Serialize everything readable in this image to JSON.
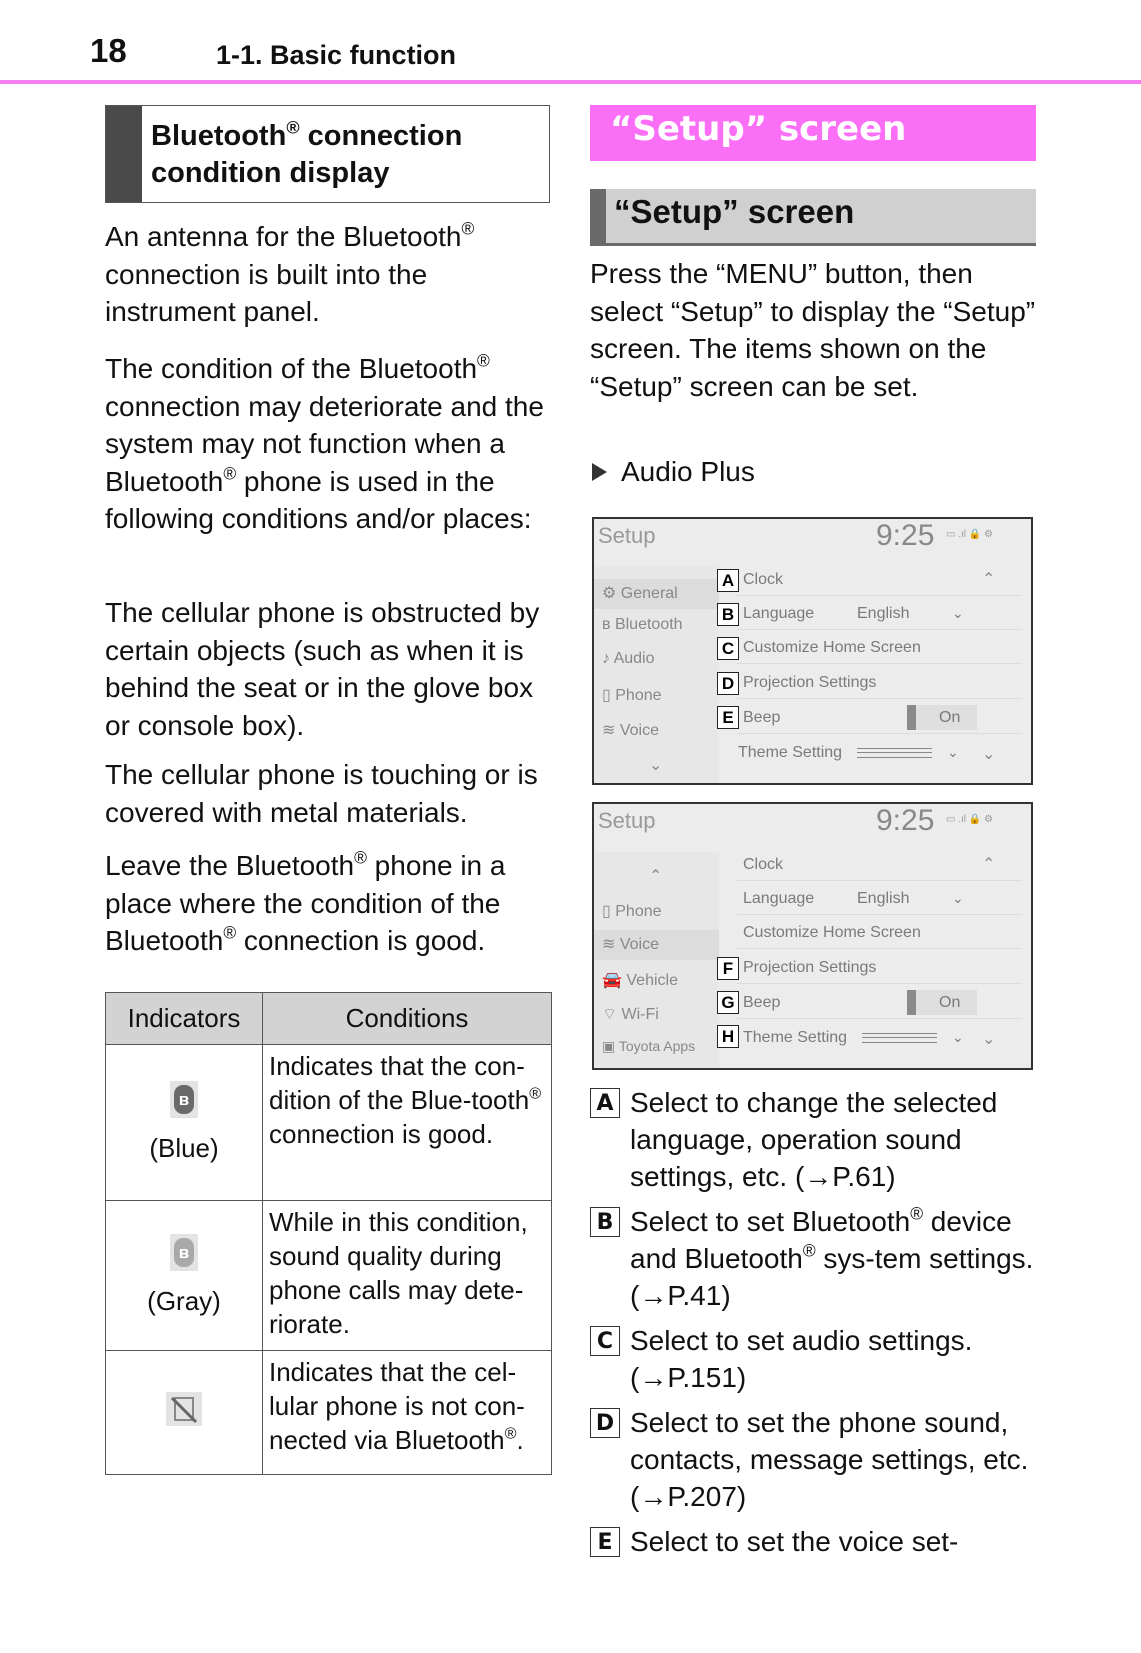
{
  "header": {
    "page_number": "18",
    "chapter": "1-1. Basic function",
    "accent_color": "#f47ef0"
  },
  "left": {
    "section_title_line1": "Bluetooth",
    "section_title_line1_rest": " connection",
    "section_title_line2": "condition display",
    "para1": [
      "An antenna for the Bluetooth",
      "connection is built into the instrument panel."
    ],
    "para2_a": "The condition of the Bluetooth",
    "para2_b": "connection may deteriorate and the system may not function when a Bluetooth",
    "para2_c": "phone is used in the following conditions and/or places:",
    "para3": "The cellular phone is obstructed by certain objects (such as when it is behind the seat or in the glove box or console box).",
    "para4": "The cellular phone is touching or is covered with metal materials.",
    "para5_a": "Leave the Bluetooth",
    "para5_b": "phone in a place where the condition of the Bluetooth",
    "para5_c": "connection is good.",
    "reg": "®",
    "table": {
      "headers": [
        "Indicators",
        "Conditions"
      ],
      "rows": [
        {
          "icon": "bluetooth-blue-icon",
          "icon_color": "#6a6a6a",
          "label": "(Blue)",
          "condition_a": "Indicates that the con-dition of the Blue-tooth",
          "condition_b": "connection is good."
        },
        {
          "icon": "bluetooth-gray-icon",
          "icon_color": "#a9a9a9",
          "label": "(Gray)",
          "condition_a": "While in this condition, sound quality during phone calls may dete-riorate.",
          "condition_b": ""
        },
        {
          "icon": "phone-not-connected-icon",
          "icon_color": "#888888",
          "label": "",
          "condition_a": "Indicates that the cel-lular phone is not con-nected via Bluetooth",
          "condition_b": "."
        }
      ]
    }
  },
  "right": {
    "pink_title": "“Setup” screen",
    "gray_title": "“Setup” screen",
    "intro": "Press the “MENU” button, then select “Setup” to display the “Setup” screen. The items shown on the “Setup” screen can be set.",
    "bullet": "Audio Plus",
    "screen1": {
      "title": "Setup",
      "time": "9:25",
      "sidebar": [
        "General",
        "Bluetooth",
        "Audio",
        "Phone",
        "Voice"
      ],
      "rows": [
        "Clock",
        "Language",
        "Customize Home Screen",
        "Projection Settings",
        "Beep",
        "Theme Setting"
      ],
      "language_value": "English",
      "beep_value": "On",
      "callouts": [
        "A",
        "B",
        "C",
        "D",
        "E"
      ]
    },
    "screen2": {
      "title": "Setup",
      "time": "9:25",
      "sidebar": [
        "Phone",
        "Voice",
        "Vehicle",
        "Wi-Fi",
        "Toyota Apps"
      ],
      "rows": [
        "Clock",
        "Language",
        "Customize Home Screen",
        "Projection Settings",
        "Beep",
        "Theme Setting"
      ],
      "language_value": "English",
      "beep_value": "On",
      "callouts": [
        "F",
        "G",
        "H"
      ]
    },
    "legend": [
      {
        "key": "A",
        "text": "Select to change the selected language, operation sound settings, etc. (→P.61)"
      },
      {
        "key": "B",
        "text_a": "Select to set Bluetooth",
        "text_b": "device and Bluetooth",
        "text_c": "sys-tem settings. (→P.41)"
      },
      {
        "key": "C",
        "text": "Select to set audio settings. (→P.151)"
      },
      {
        "key": "D",
        "text": "Select to set the phone sound, contacts, message settings, etc. (→P.207)"
      },
      {
        "key": "E",
        "text": "Select to set the voice set-"
      }
    ]
  }
}
